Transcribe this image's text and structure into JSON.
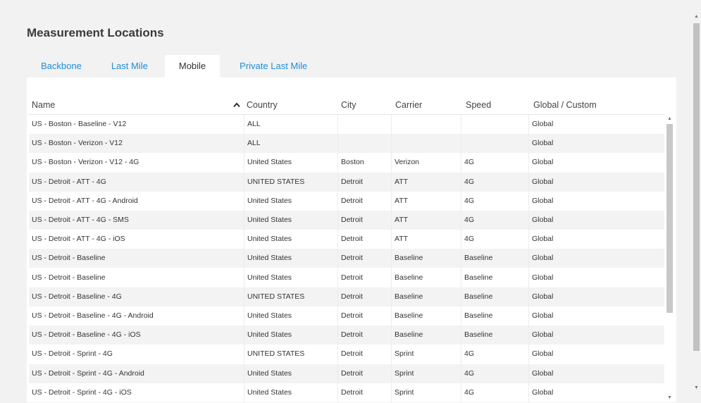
{
  "title": "Measurement Locations",
  "tabs": [
    {
      "label": "Backbone",
      "active": false
    },
    {
      "label": "Last Mile",
      "active": false
    },
    {
      "label": "Mobile",
      "active": true
    },
    {
      "label": "Private Last Mile",
      "active": false
    }
  ],
  "columns": {
    "name": "Name",
    "country": "Country",
    "city": "City",
    "carrier": "Carrier",
    "speed": "Speed",
    "global": "Global / Custom"
  },
  "sort": {
    "column": "name",
    "icon": "chevron-up-icon"
  },
  "rows": [
    {
      "name": "US - Boston - Baseline - V12",
      "country": "ALL",
      "city": "",
      "carrier": "",
      "speed": "",
      "global": "Global"
    },
    {
      "name": "US - Boston - Verizon - V12",
      "country": "ALL",
      "city": "",
      "carrier": "",
      "speed": "",
      "global": "Global"
    },
    {
      "name": "US - Boston - Verizon - V12 - 4G",
      "country": "United States",
      "city": "Boston",
      "carrier": "Verizon",
      "speed": "4G",
      "global": "Global"
    },
    {
      "name": "US - Detroit - ATT - 4G",
      "country": "UNITED STATES",
      "city": "Detroit",
      "carrier": "ATT",
      "speed": "4G",
      "global": "Global"
    },
    {
      "name": "US - Detroit - ATT - 4G - Android",
      "country": "United States",
      "city": "Detroit",
      "carrier": "ATT",
      "speed": "4G",
      "global": "Global"
    },
    {
      "name": "US - Detroit - ATT - 4G - SMS",
      "country": "United States",
      "city": "Detroit",
      "carrier": "ATT",
      "speed": "4G",
      "global": "Global"
    },
    {
      "name": "US - Detroit - ATT - 4G - iOS",
      "country": "United States",
      "city": "Detroit",
      "carrier": "ATT",
      "speed": "4G",
      "global": "Global"
    },
    {
      "name": "US - Detroit - Baseline",
      "country": "United States",
      "city": "Detroit",
      "carrier": "Baseline",
      "speed": "Baseline",
      "global": "Global"
    },
    {
      "name": "US - Detroit - Baseline",
      "country": "United States",
      "city": "Detroit",
      "carrier": "Baseline",
      "speed": "Baseline",
      "global": "Global"
    },
    {
      "name": "US - Detroit - Baseline - 4G",
      "country": "UNITED STATES",
      "city": "Detroit",
      "carrier": "Baseline",
      "speed": "Baseline",
      "global": "Global"
    },
    {
      "name": "US - Detroit - Baseline - 4G - Android",
      "country": "United States",
      "city": "Detroit",
      "carrier": "Baseline",
      "speed": "Baseline",
      "global": "Global"
    },
    {
      "name": "US - Detroit - Baseline - 4G - iOS",
      "country": "United States",
      "city": "Detroit",
      "carrier": "Baseline",
      "speed": "Baseline",
      "global": "Global"
    },
    {
      "name": "US - Detroit - Sprint - 4G",
      "country": "UNITED STATES",
      "city": "Detroit",
      "carrier": "Sprint",
      "speed": "4G",
      "global": "Global"
    },
    {
      "name": "US - Detroit - Sprint - 4G - Android",
      "country": "United States",
      "city": "Detroit",
      "carrier": "Sprint",
      "speed": "4G",
      "global": "Global"
    },
    {
      "name": "US - Detroit - Sprint - 4G - iOS",
      "country": "United States",
      "city": "Detroit",
      "carrier": "Sprint",
      "speed": "4G",
      "global": "Global"
    }
  ],
  "colors": {
    "link": "#1f8dd6",
    "panel": "#ffffff",
    "background": "#f2f2f2",
    "row_alt": "#f3f3f3"
  }
}
